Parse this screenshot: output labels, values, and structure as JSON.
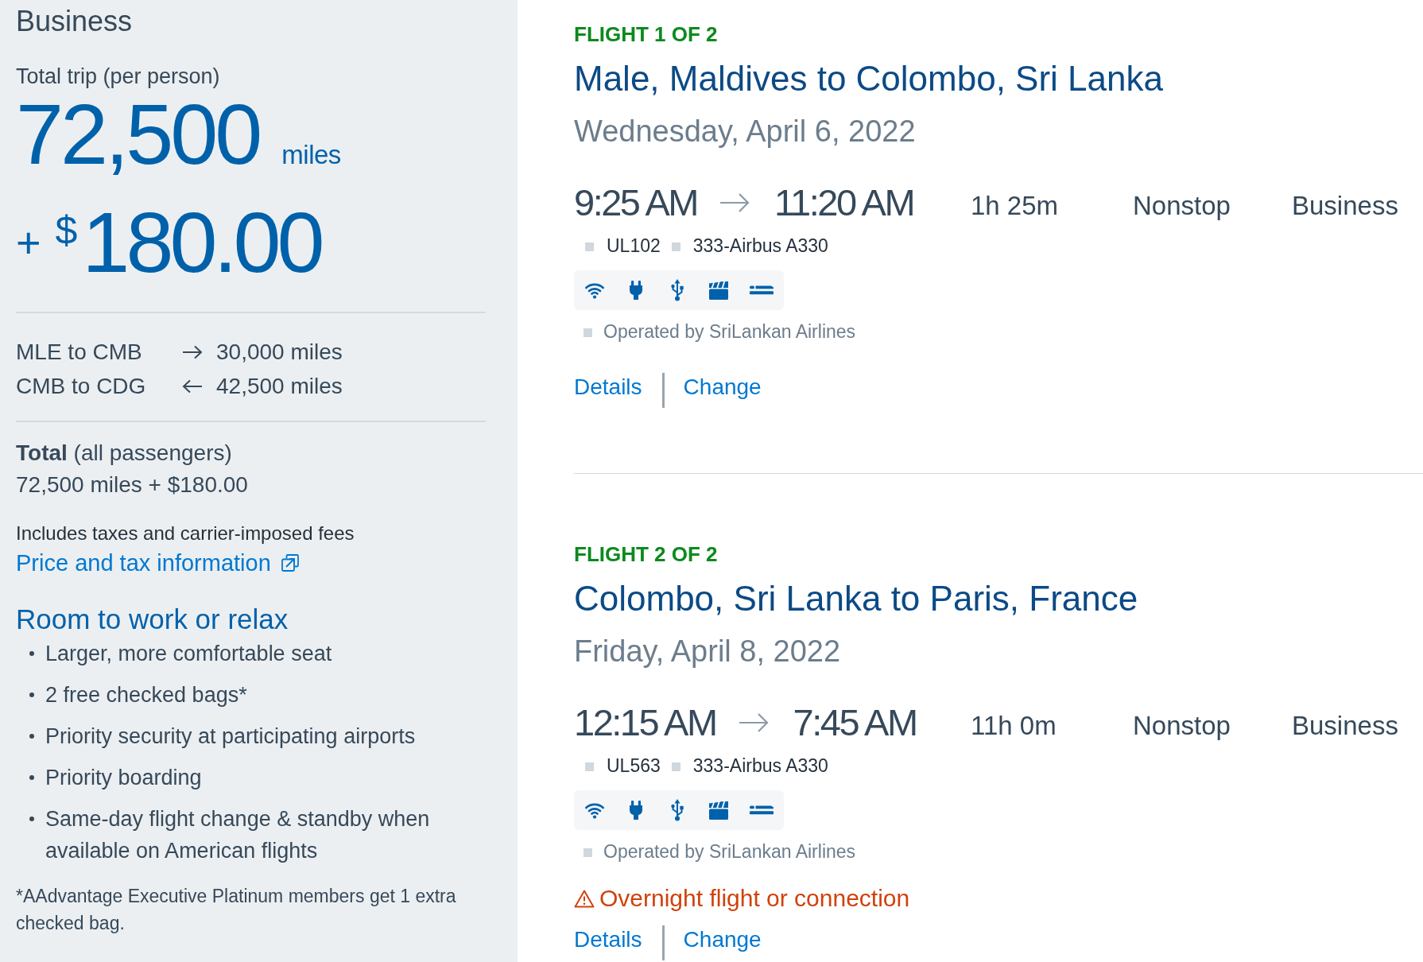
{
  "fare_summary": {
    "cabin": "Business",
    "per_person_label": "Total trip (per person)",
    "miles": {
      "amount": "72,500",
      "unit": "miles"
    },
    "cash": {
      "prefix": "+",
      "currency": "$",
      "amount": "180.00"
    },
    "legs": [
      {
        "route": "MLE to CMB",
        "kind": "outbound",
        "miles": "30,000 miles"
      },
      {
        "route": "CMB to CDG",
        "kind": "return",
        "miles": "42,500 miles"
      }
    ],
    "total_label": "**Total** (all passengers)",
    "total_value": "72,500 miles + $180.00",
    "taxes_note": "Includes taxes and carrier-imposed fees",
    "price_link": "Price and tax information"
  },
  "benefits": {
    "heading": "Room to work or relax",
    "items": [
      "Larger, more comfortable seat",
      "2 free checked bags*",
      "Priority security at participating airports",
      "Priority boarding",
      "Same-day flight change & standby when available on American flights"
    ],
    "footnote": "*AAdvantage Executive Platinum members get 1 extra checked bag."
  },
  "flights": [
    {
      "heading": "FLIGHT 1 OF 2",
      "route": "Male, Maldives to Colombo, Sri Lanka",
      "date": "Wednesday, April 6, 2022",
      "depart": "9:25 AM",
      "arrive": "11:20 AM",
      "duration": "1h 25m",
      "stops": "Nonstop",
      "cabin": "Business",
      "flight_number": "UL102",
      "aircraft": "333-Airbus A330",
      "amenities": [
        {
          "kind": "wifi"
        },
        {
          "kind": "power"
        },
        {
          "kind": "usb"
        },
        {
          "kind": "entertainment"
        },
        {
          "kind": "lie-flat-seat"
        }
      ],
      "operator": "Operated by SriLankan Airlines",
      "actions": [
        "Details",
        "Change"
      ]
    },
    {
      "heading": "FLIGHT 2 OF 2",
      "route": "Colombo, Sri Lanka to Paris, France",
      "date": "Friday, April 8, 2022",
      "depart": "12:15 AM",
      "arrive": "7:45 AM",
      "duration": "11h 0m",
      "stops": "Nonstop",
      "cabin": "Business",
      "flight_number": "UL563",
      "aircraft": "333-Airbus A330",
      "amenities": [
        {
          "kind": "wifi"
        },
        {
          "kind": "power"
        },
        {
          "kind": "usb"
        },
        {
          "kind": "entertainment"
        },
        {
          "kind": "lie-flat-seat"
        }
      ],
      "operator": "Operated by SriLankan Airlines",
      "warning": "Overnight flight or connection",
      "actions": [
        "Details",
        "Change"
      ]
    }
  ]
}
